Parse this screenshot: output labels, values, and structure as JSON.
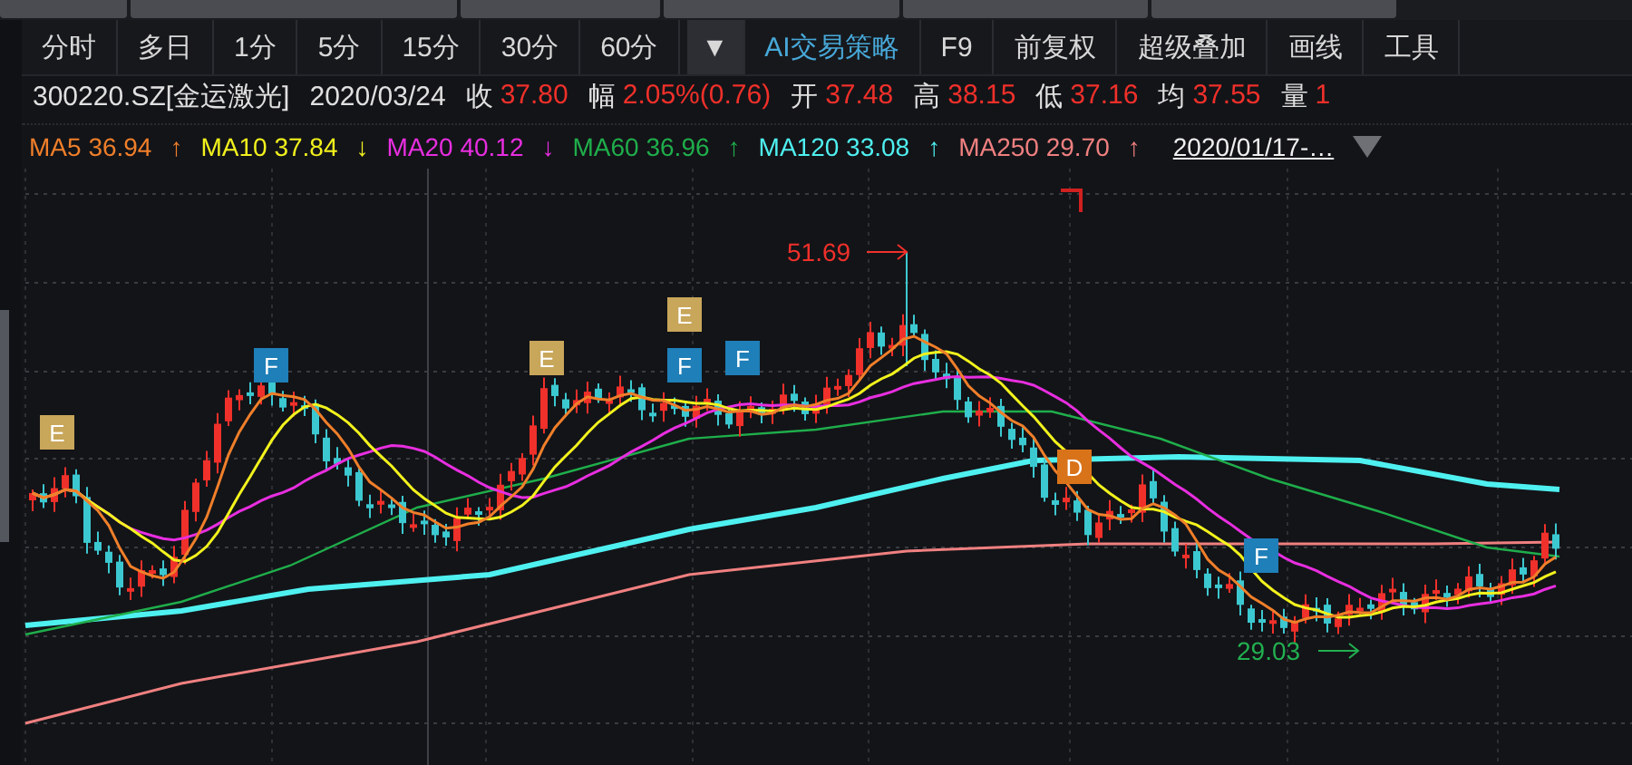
{
  "tabs": [
    {
      "label": "分时",
      "kind": "plain"
    },
    {
      "label": "多日",
      "kind": "plain"
    },
    {
      "label": "1分",
      "kind": "plain"
    },
    {
      "label": "5分",
      "kind": "plain"
    },
    {
      "label": "15分",
      "kind": "plain"
    },
    {
      "label": "30分",
      "kind": "plain"
    },
    {
      "label": "60分",
      "kind": "plain"
    },
    {
      "label": "▼",
      "kind": "menu"
    },
    {
      "label": "AI交易策略",
      "kind": "accent"
    },
    {
      "label": "F9",
      "kind": "plain"
    },
    {
      "label": "前复权",
      "kind": "plain"
    },
    {
      "label": "超级叠加",
      "kind": "plain"
    },
    {
      "label": "画线",
      "kind": "plain"
    },
    {
      "label": "工具",
      "kind": "plain"
    }
  ],
  "quote": {
    "symbol": "300220.SZ[金运激光]",
    "date": "2020/03/24",
    "fields": [
      {
        "label": "收",
        "value": "37.80"
      },
      {
        "label": "幅",
        "value": "2.05%(0.76)"
      },
      {
        "label": "开",
        "value": "37.48"
      },
      {
        "label": "高",
        "value": "38.15"
      },
      {
        "label": "低",
        "value": "37.16"
      },
      {
        "label": "均",
        "value": "37.55"
      },
      {
        "label": "量",
        "value": "1"
      }
    ]
  },
  "ma_lines": [
    {
      "name": "MA5",
      "value": "36.94",
      "trend": "↑",
      "color": "#f07f2a"
    },
    {
      "name": "MA10",
      "value": "37.84",
      "trend": "↓",
      "color": "#f2f21d"
    },
    {
      "name": "MA20",
      "value": "40.12",
      "trend": "↓",
      "color": "#e82ee0"
    },
    {
      "name": "MA60",
      "value": "36.96",
      "trend": "↑",
      "color": "#1fae4b"
    },
    {
      "name": "MA120",
      "value": "33.08",
      "trend": "↑",
      "color": "#4ff0f0"
    },
    {
      "name": "MA250",
      "value": "29.70",
      "trend": "↑",
      "color": "#f08080"
    }
  ],
  "date_range": "2020/01/17-…",
  "chart": {
    "high_label": "51.69",
    "low_label": "29.03",
    "markers": [
      {
        "letter": "E",
        "color": "#c8a65a"
      },
      {
        "letter": "F",
        "color": "#1f7fb8"
      },
      {
        "letter": "E",
        "color": "#c8a65a"
      },
      {
        "letter": "E",
        "color": "#c8a65a"
      },
      {
        "letter": "F",
        "color": "#1f7fb8"
      },
      {
        "letter": "F",
        "color": "#1f7fb8"
      },
      {
        "letter": "D",
        "color": "#d9731a"
      },
      {
        "letter": "F",
        "color": "#1f7fb8"
      }
    ]
  }
}
